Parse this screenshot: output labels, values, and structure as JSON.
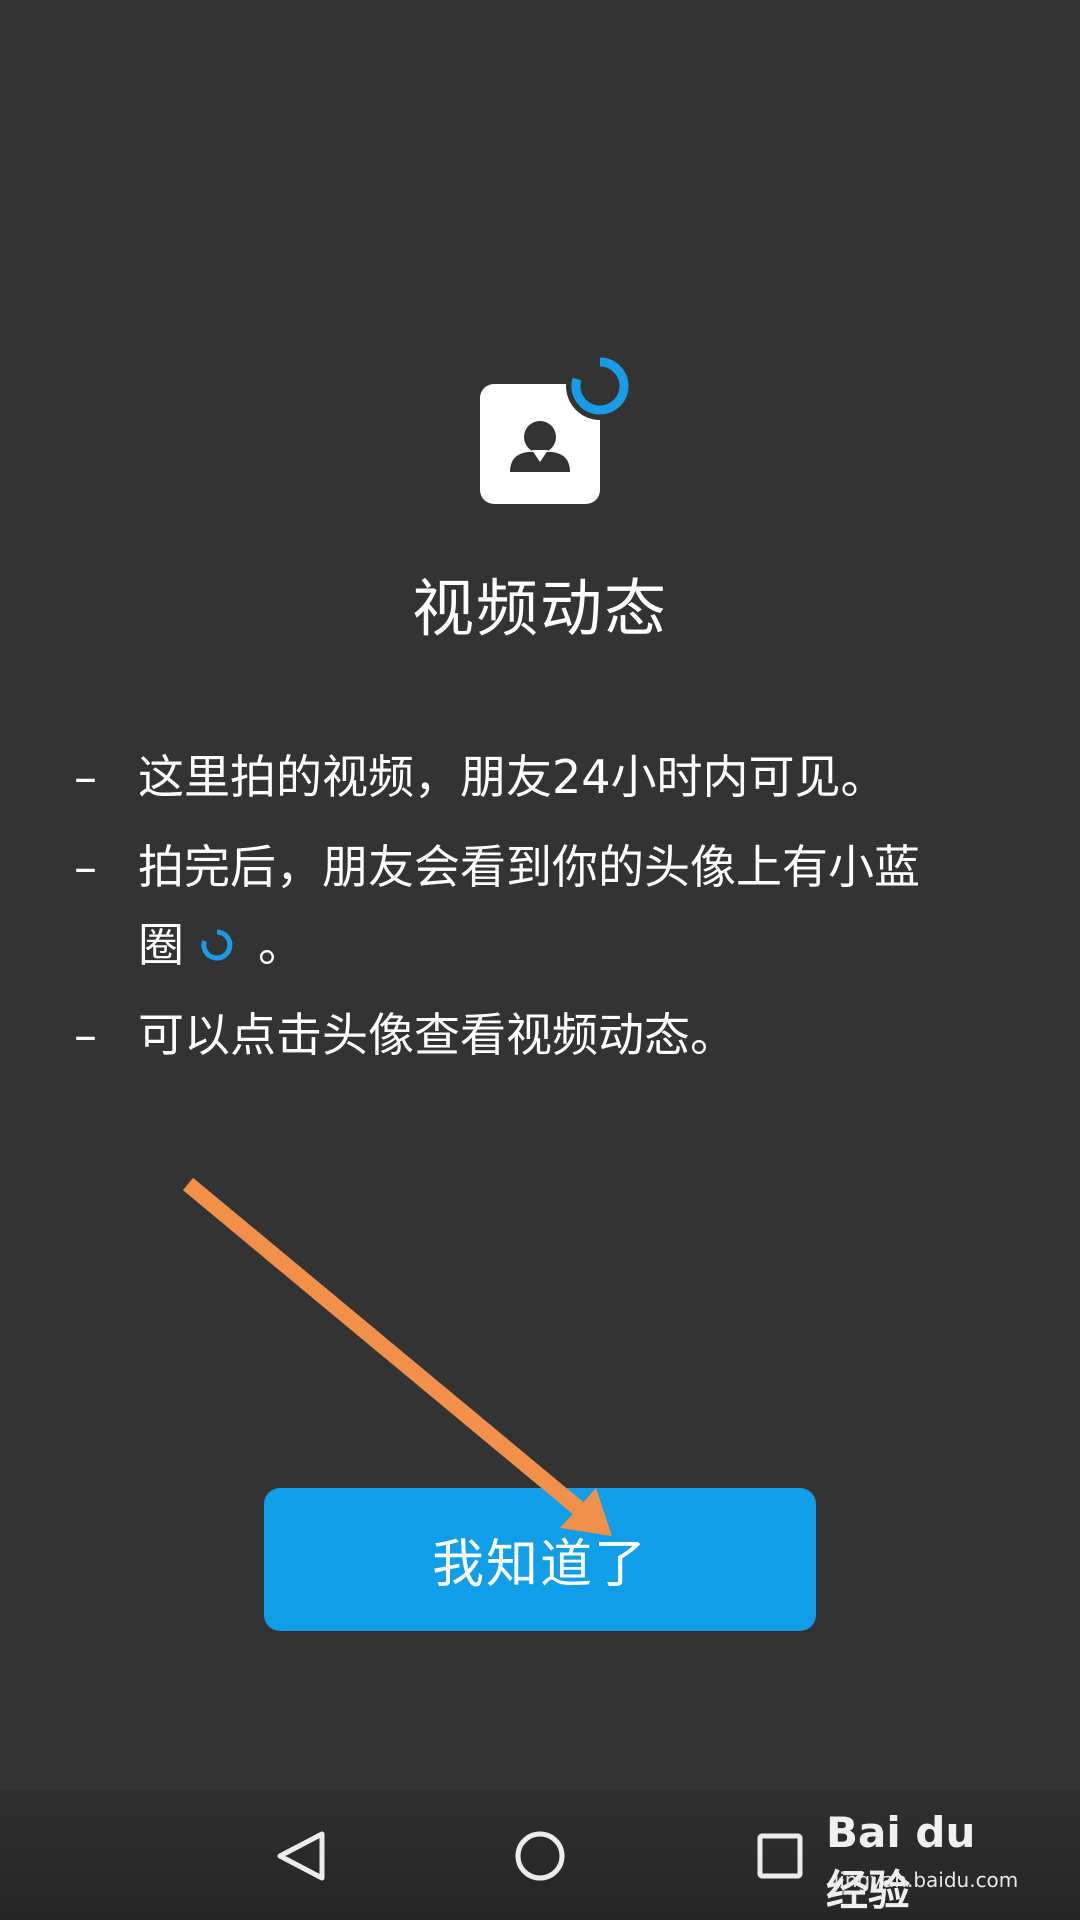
{
  "dialog": {
    "title": "视频动态",
    "bullet": "–",
    "tips": [
      "这里拍的视频，朋友24小时内可见。",
      "拍完后，朋友会看到你的头像上有小蓝",
      "可以点击头像查看视频动态。"
    ],
    "tip2_continuation": "圈",
    "tip2_end": "。",
    "confirm_label": "我知道了"
  },
  "watermark": {
    "brand": "Bai du 经验",
    "url": "jingyan.baidu.com"
  },
  "colors": {
    "background": "#333333",
    "accent_blue": "#109ee8",
    "ring_blue": "#1a9be6",
    "annotation_arrow": "#f0904a"
  },
  "icons": {
    "avatar": "person-icon",
    "badge": "blue-ring-icon",
    "nav_back": "back-triangle-icon",
    "nav_home": "home-circle-icon",
    "nav_recents": "recents-square-icon"
  }
}
